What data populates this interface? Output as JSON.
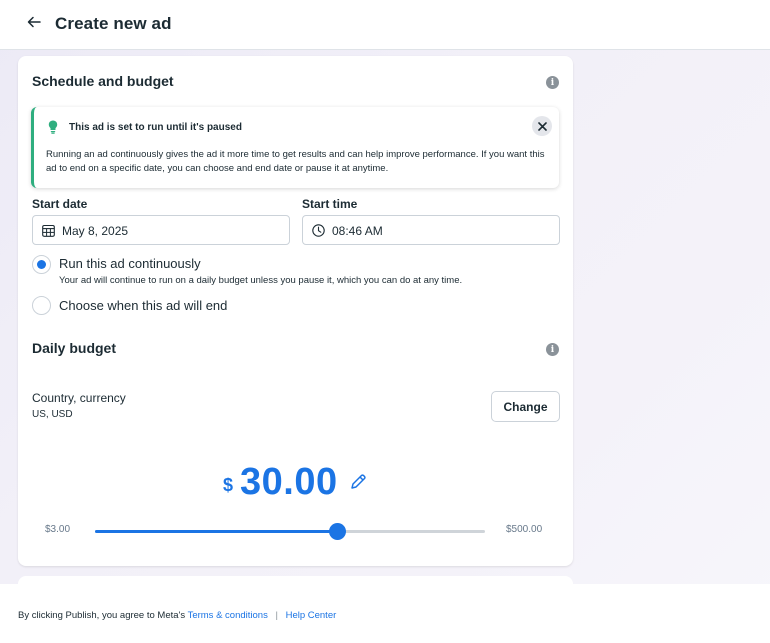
{
  "header": {
    "title": "Create new ad",
    "back_icon": "arrow-left-icon"
  },
  "schedule": {
    "title": "Schedule and budget",
    "notice": {
      "title": "This ad is set to run until it's paused",
      "body": "Running an ad continuously gives the ad it more time to get results and can help improve performance. If you want this ad to end on a specific date, you can choose and end date or pause it at anytime.",
      "accent_color": "#2fae7f"
    },
    "start_date": {
      "label": "Start date",
      "value": "May 8, 2025",
      "icon": "calendar-icon"
    },
    "start_time": {
      "label": "Start time",
      "value": "08:46 AM",
      "icon": "clock-icon"
    },
    "options": [
      {
        "label": "Run this ad continuously",
        "help": "Your ad will continue to run on a daily budget unless you pause it, which you can do at any time.",
        "selected": true
      },
      {
        "label": "Choose when this ad will end",
        "selected": false
      }
    ]
  },
  "budget": {
    "title": "Daily budget",
    "country_label": "Country, currency",
    "country_value": "US, USD",
    "change_label": "Change",
    "currency_symbol": "$",
    "amount": "30.00",
    "slider": {
      "min_label": "$3.00",
      "max_label": "$500.00",
      "fill_fraction": 0.62
    },
    "accent_color": "#1b74e4"
  },
  "footer": {
    "prefix": "By clicking Publish, you agree to Meta's",
    "terms_link": "Terms & conditions",
    "separator": "|",
    "help_link": "Help Center"
  }
}
